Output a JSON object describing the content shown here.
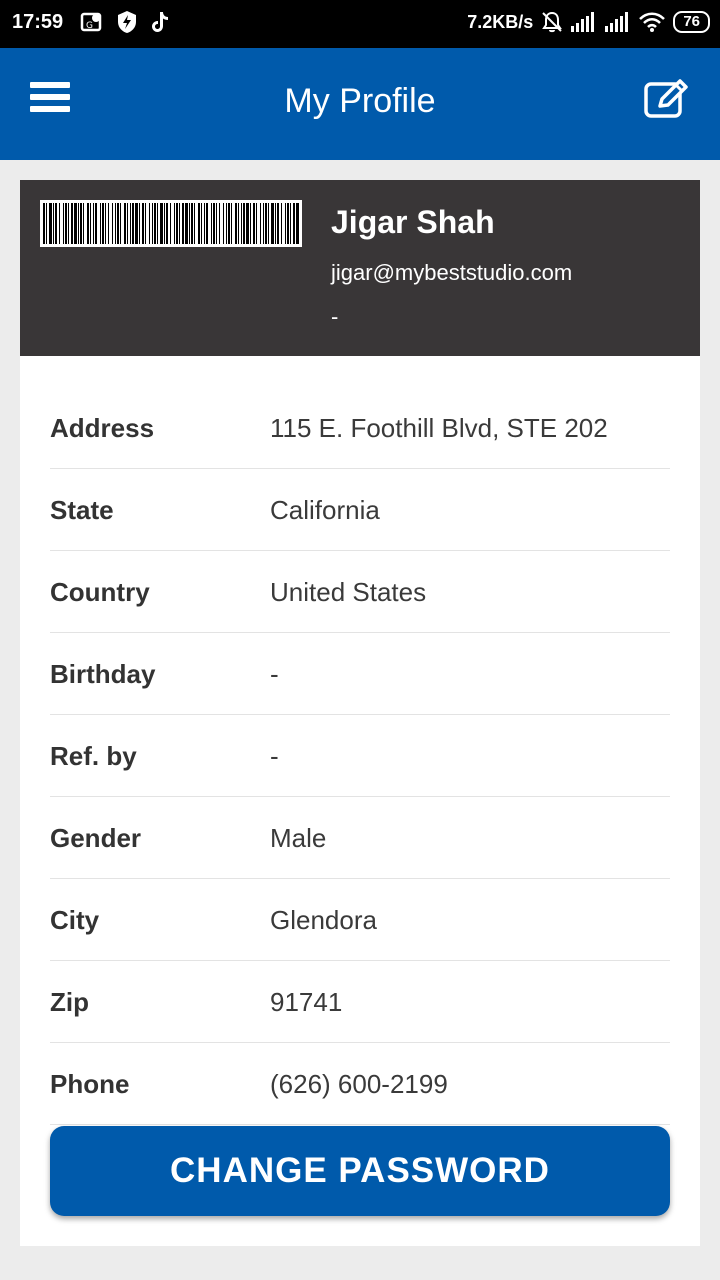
{
  "status_bar": {
    "time": "17:59",
    "network_speed": "7.2KB/s",
    "battery": "76",
    "icons": [
      "gallery-location-icon",
      "shield-bolt-icon",
      "tiktok-icon",
      "mute-bell-icon",
      "signal-icon",
      "signal-icon",
      "wifi-icon",
      "battery-icon"
    ]
  },
  "app_bar": {
    "title": "My Profile",
    "menu_icon": "hamburger-menu-icon",
    "edit_icon": "edit-icon"
  },
  "profile": {
    "name": "Jigar Shah",
    "email": "jigar@mybeststudio.com",
    "extra": "-"
  },
  "details": [
    {
      "label": "Address",
      "value": "115 E. Foothill Blvd, STE 202"
    },
    {
      "label": "State",
      "value": "California"
    },
    {
      "label": "Country",
      "value": "United States"
    },
    {
      "label": "Birthday",
      "value": "-"
    },
    {
      "label": "Ref. by",
      "value": "-"
    },
    {
      "label": "Gender",
      "value": "Male"
    },
    {
      "label": "City",
      "value": "Glendora"
    },
    {
      "label": "Zip",
      "value": "91741"
    },
    {
      "label": "Phone",
      "value": "(626) 600-2199"
    }
  ],
  "change_password_label": "CHANGE PASSWORD",
  "colors": {
    "primary": "#005aab",
    "header_dark": "#393637",
    "background": "#ececec"
  }
}
